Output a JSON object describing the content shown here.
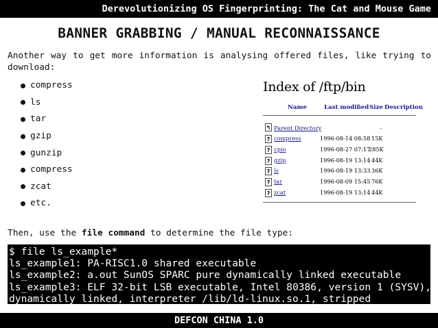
{
  "header": {
    "title": "Derevolutionizing OS Fingerprinting: The Cat and Mouse Game"
  },
  "slide": {
    "heading": "BANNER GRABBING / MANUAL RECONNAISSANCE",
    "intro": "Another way to get more information is analysing offered files, like trying to download:",
    "bullets": [
      "compress",
      "ls",
      "tar",
      "gzip",
      "gunzip",
      "compress",
      "zcat",
      "etc."
    ],
    "then_prefix": "Then, use the ",
    "then_bold": "file command",
    "then_suffix": " to determine the file type:",
    "terminal_lines": [
      "$ file ls_example*",
      "ls_example1: PA-RISC1.0 shared executable",
      "ls_example2: a.out SunOS SPARC pure dynamically linked executable",
      "ls_example3: ELF 32-bit LSB executable, Intel 80386, version 1 (SYSV),",
      "dynamically linked, interpreter /lib/ld-linux.so.1, stripped"
    ]
  },
  "ftp_index": {
    "title": "Index of /ftp/bin",
    "columns": {
      "name": "Name",
      "modified": "Last modified",
      "size": "Size",
      "description": "Description"
    },
    "parent": {
      "name": "Parent Directory",
      "size": "-"
    },
    "rows": [
      {
        "name": "compress",
        "modified": "1996-08-14 08:58",
        "size": "15K"
      },
      {
        "name": "cpio",
        "modified": "1996-08-27 07:17",
        "size": "285K"
      },
      {
        "name": "gzip",
        "modified": "1996-08-19 13:14",
        "size": "44K"
      },
      {
        "name": "ls",
        "modified": "1996-08-19 13:33",
        "size": "36K"
      },
      {
        "name": "tar",
        "modified": "1996-08-09 15:45",
        "size": "76K"
      },
      {
        "name": "zcat",
        "modified": "1996-08-19 13:14",
        "size": "44K"
      }
    ]
  },
  "footer": {
    "text": "DEFCON CHINA 1.0"
  }
}
